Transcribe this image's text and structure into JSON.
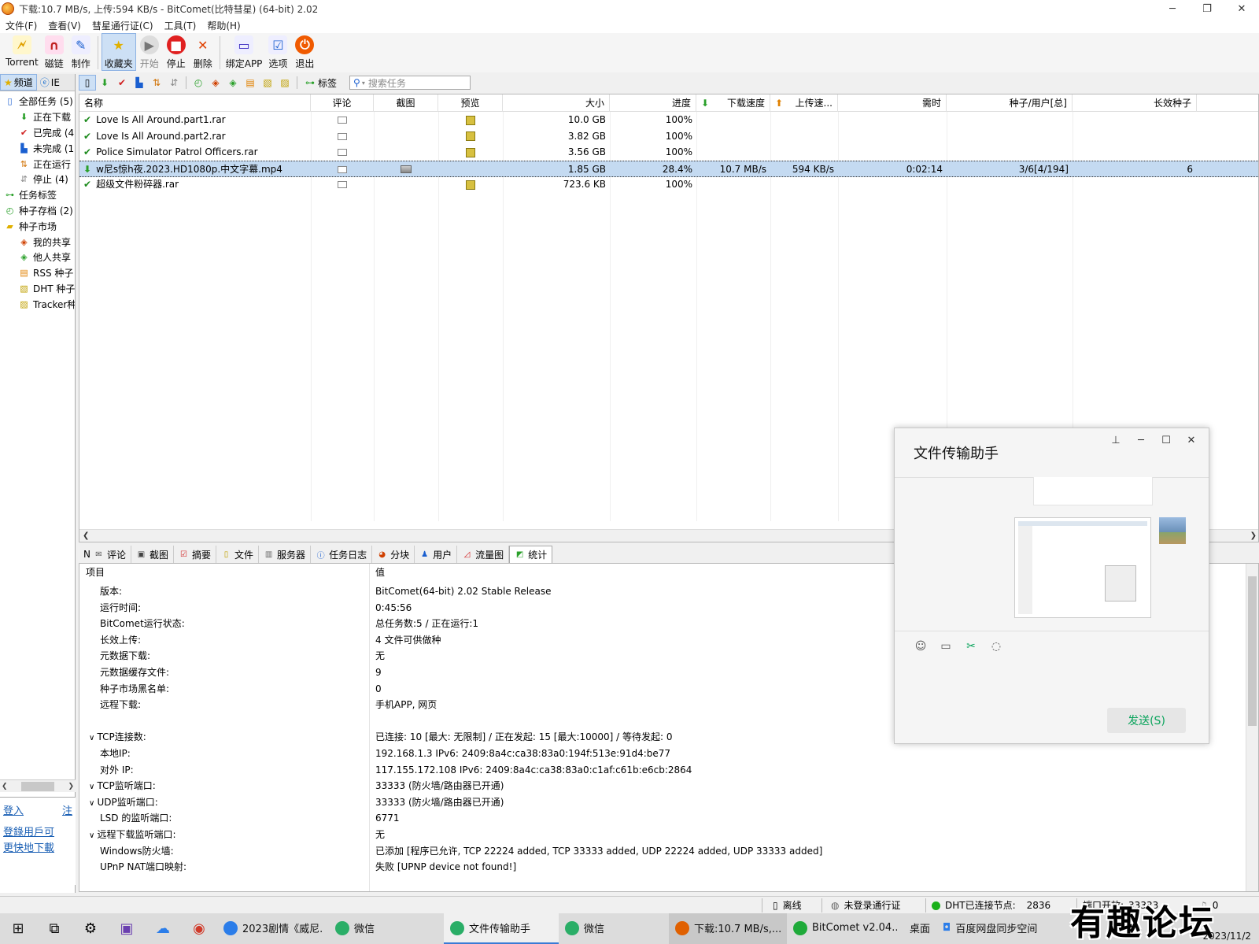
{
  "window": {
    "title": "下载:10.7 MB/s, 上传:594 KB/s - BitComet(比特彗星) (64-bit) 2.02"
  },
  "menubar": [
    "文件(F)",
    "查看(V)",
    "彗星通行证(C)",
    "工具(T)",
    "帮助(H)"
  ],
  "toolbar": [
    {
      "label": "Torrent",
      "icon": "torrent-icon",
      "state": "normal"
    },
    {
      "label": "磁链",
      "icon": "magnet-icon",
      "state": "normal"
    },
    {
      "label": "制作",
      "icon": "make-torrent-icon",
      "state": "normal"
    },
    {
      "label": "收藏夹",
      "icon": "star-icon",
      "state": "active"
    },
    {
      "label": "开始",
      "icon": "play-icon",
      "state": "disabled"
    },
    {
      "label": "停止",
      "icon": "stop-icon",
      "state": "normal"
    },
    {
      "label": "删除",
      "icon": "delete-x-icon",
      "state": "normal"
    },
    {
      "label": "绑定APP",
      "icon": "bind-app-icon",
      "state": "normal"
    },
    {
      "label": "选项",
      "icon": "options-icon",
      "state": "normal"
    },
    {
      "label": "退出",
      "icon": "power-icon",
      "state": "normal"
    }
  ],
  "left_panel": {
    "tabs": [
      "频道",
      "IE"
    ],
    "tree": [
      {
        "label": "全部任务 (5)",
        "indent": 0,
        "icon": "all-tasks-icon"
      },
      {
        "label": "正在下载",
        "indent": 1,
        "icon": "download-arrow-icon"
      },
      {
        "label": "已完成 (4",
        "indent": 1,
        "icon": "check-icon"
      },
      {
        "label": "未完成 (1",
        "indent": 1,
        "icon": "incomplete-icon"
      },
      {
        "label": "正在运行",
        "indent": 1,
        "icon": "running-icon"
      },
      {
        "label": "停止 (4)",
        "indent": 1,
        "icon": "stopped-icon"
      },
      {
        "label": "任务标签",
        "indent": 0,
        "icon": "tag-icon"
      },
      {
        "label": "种子存档 (2)",
        "indent": 0,
        "icon": "archive-icon"
      },
      {
        "label": "种子市场",
        "indent": 0,
        "icon": "folder-icon"
      },
      {
        "label": "我的共享",
        "indent": 1,
        "icon": "my-share-icon"
      },
      {
        "label": "他人共享",
        "indent": 1,
        "icon": "others-share-icon"
      },
      {
        "label": "RSS 种子",
        "indent": 1,
        "icon": "rss-icon"
      },
      {
        "label": "DHT 种子",
        "indent": 1,
        "icon": "dht-icon"
      },
      {
        "label": "Tracker种",
        "indent": 1,
        "icon": "tracker-icon"
      }
    ],
    "login": "登入",
    "register": "注",
    "hint_lines": [
      "登錄用戶可",
      "更快地下載"
    ]
  },
  "toolbar2": {
    "tag_label": "标签",
    "search_placeholder": "搜索任务"
  },
  "tasklist": {
    "columns": [
      "名称",
      "评论",
      "截图",
      "预览",
      "大小",
      "进度",
      "下载速度",
      "上传速...",
      "需时",
      "种子/用户[总]",
      "长效种子"
    ],
    "rows": [
      {
        "name": "Love Is All Around.part1.rar",
        "status": "done",
        "has_shot": false,
        "has_preview": true,
        "size": "10.0 GB",
        "progress": "100%",
        "down": "",
        "up": "",
        "eta": "",
        "peers": "",
        "seeds": ""
      },
      {
        "name": "Love Is All Around.part2.rar",
        "status": "done",
        "has_shot": false,
        "has_preview": true,
        "size": "3.82 GB",
        "progress": "100%",
        "down": "",
        "up": "",
        "eta": "",
        "peers": "",
        "seeds": ""
      },
      {
        "name": "Police Simulator Patrol Officers.rar",
        "status": "done",
        "has_shot": false,
        "has_preview": true,
        "size": "3.56 GB",
        "progress": "100%",
        "down": "",
        "up": "",
        "eta": "",
        "peers": "",
        "seeds": ""
      },
      {
        "name": "w尼s惊h夜.2023.HD1080p.中文字幕.mp4",
        "status": "downloading",
        "has_shot": true,
        "has_preview": false,
        "size": "1.85 GB",
        "progress": "28.4%",
        "down": "10.7 MB/s",
        "up": "594 KB/s",
        "eta": "0:02:14",
        "peers": "3/6[4/194]",
        "seeds": "6"
      },
      {
        "name": "超级文件粉碎器.rar",
        "status": "done",
        "has_shot": false,
        "has_preview": true,
        "size": "723.6 KB",
        "progress": "100%",
        "down": "",
        "up": "",
        "eta": "",
        "peers": "",
        "seeds": ""
      }
    ]
  },
  "detail_tabs": [
    {
      "label": "评论",
      "icon": "comment-icon"
    },
    {
      "label": "截图",
      "icon": "screenshot-icon"
    },
    {
      "label": "摘要",
      "icon": "summary-icon"
    },
    {
      "label": "文件",
      "icon": "file-icon"
    },
    {
      "label": "服务器",
      "icon": "server-icon"
    },
    {
      "label": "任务日志",
      "icon": "log-icon"
    },
    {
      "label": "分块",
      "icon": "pieces-icon"
    },
    {
      "label": "用户",
      "icon": "user-icon"
    },
    {
      "label": "流量图",
      "icon": "traffic-chart-icon"
    },
    {
      "label": "统计",
      "icon": "stats-icon"
    }
  ],
  "detail_tab_first_prefix": "N",
  "detail": {
    "header_key": "项目",
    "header_val": "值",
    "rows": [
      {
        "k": "版本:",
        "v": "BitComet(64-bit) 2.02 Stable Release",
        "exp": false
      },
      {
        "k": "运行时间:",
        "v": "0:45:56",
        "exp": false
      },
      {
        "k": "BitComet运行状态:",
        "v": "总任务数:5 / 正在运行:1",
        "exp": false
      },
      {
        "k": "长效上传:",
        "v": "4 文件可供做种",
        "exp": false
      },
      {
        "k": "元数据下载:",
        "v": "无",
        "exp": false
      },
      {
        "k": "元数据缓存文件:",
        "v": "9",
        "exp": false
      },
      {
        "k": "种子市场黑名单:",
        "v": "0",
        "exp": false
      },
      {
        "k": "远程下载:",
        "v": "手机APP, 网页",
        "exp": false
      },
      {
        "k": "",
        "v": "",
        "exp": false
      },
      {
        "k": "TCP连接数:",
        "v": "已连接: 10 [最大: 无限制] / 正在发起: 15 [最大:10000] / 等待发起: 0",
        "exp": true
      },
      {
        "k": "本地IP:",
        "v": "192.168.1.3     IPv6: 2409:8a4c:ca38:83a0:194f:513e:91d4:be77",
        "exp": false
      },
      {
        "k": "对外 IP:",
        "v": "117.155.172.108     IPv6: 2409:8a4c:ca38:83a0:c1af:c61b:e6cb:2864",
        "exp": false
      },
      {
        "k": "TCP监听端口:",
        "v": "33333 (防火墙/路由器已开通)",
        "exp": true
      },
      {
        "k": "UDP监听端口:",
        "v": "33333 (防火墙/路由器已开通)",
        "exp": true
      },
      {
        "k": "LSD 的监听端口:",
        "v": "6771",
        "exp": false
      },
      {
        "k": "远程下载监听端口:",
        "v": "无",
        "exp": true
      },
      {
        "k": "Windows防火墙:",
        "v": "已添加 [程序已允许, TCP 22224 added, TCP 33333 added, UDP 22224 added, UDP 33333 added]",
        "exp": false
      },
      {
        "k": "UPnP NAT端口映射:",
        "v": "失败 [UPNP device not found!]",
        "exp": false
      }
    ]
  },
  "wechat": {
    "title": "文件传输助手",
    "send_label": "发送(S)"
  },
  "statusbar": {
    "offline": "离线",
    "passport": "未登录通行证",
    "dht_label": "DHT已连接节点:",
    "dht_count": "2836",
    "port_label": "端口开放:",
    "port_value": "33333",
    "extra": "0"
  },
  "taskbar": {
    "apps": [
      {
        "label": "2023剧情《威尼...",
        "state": "normal",
        "color": "#2b7de9"
      },
      {
        "label": "微信",
        "state": "normal",
        "color": "#2aae67"
      },
      {
        "label": "文件传输助手",
        "state": "active",
        "color": "#2aae67"
      },
      {
        "label": "微信",
        "state": "normal",
        "color": "#2aae67"
      },
      {
        "label": "下载:10.7 MB/s,...",
        "state": "hi",
        "color": "#e06000"
      },
      {
        "label": "BitComet v2.04...",
        "state": "normal",
        "color": "#1faa3a"
      }
    ],
    "desktop": "桌面",
    "baidu": "百度网盘同步空间",
    "clock": "2023/11/2"
  },
  "watermark": "有趣论坛"
}
